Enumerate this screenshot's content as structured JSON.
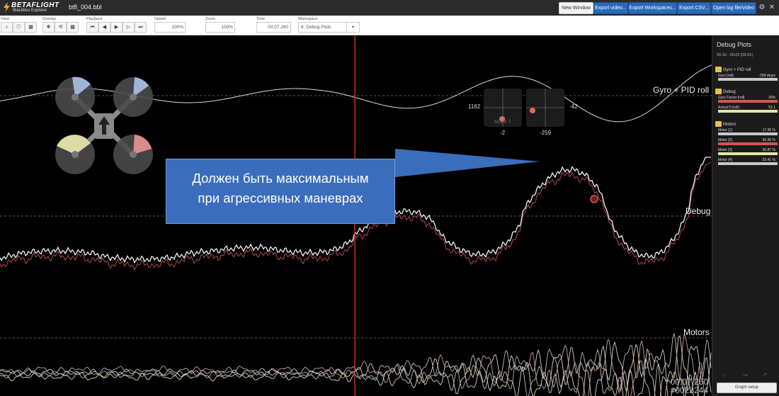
{
  "app": {
    "logo_line1": "BETAFLIGHT",
    "logo_line2": "Blackbox Explorer",
    "filename": "btfl_004.bbl"
  },
  "titlebar": {
    "new_window": "New Window",
    "export_video": "Export video...",
    "export_workspaces": "Export Workspaces...",
    "export_csv": "Export CSV...",
    "open_log": "Open log file/video"
  },
  "toolbar": {
    "view_label": "View",
    "overlay_label": "Overlay",
    "playback_label": "Playback",
    "speed_label": "Speed",
    "speed_value": "100%",
    "zoom_label": "Zoom",
    "zoom_value": "100%",
    "time_label": "Time",
    "time_value": "00:07.260",
    "workspace_label": "Workspace",
    "workspace_value": "6: Debug Plots"
  },
  "graph": {
    "label_gyro": "Gyro + PID roll",
    "label_debug": "Debug",
    "label_motors": "Motors",
    "stick_left_x": "-2",
    "stick_left_y": "1162",
    "stick_right_x": "-259",
    "stick_right_y": "-42",
    "stick_mode": "Mode 2",
    "callout_line1": "Должен быть максимальным",
    "callout_line2": "при агрессивных маневрах",
    "time_readout": "00:07.260",
    "frame_readout": "#0023244"
  },
  "panel": {
    "title": "Debug Plots",
    "range": "00:16 - 00:22 [00:01]",
    "sections": [
      {
        "name": "Gyro + PID roll",
        "series": [
          {
            "name": "Gyro [roll]",
            "value": "-258 deg/s",
            "color": "#c8c8c8"
          }
        ]
      },
      {
        "name": "Debug",
        "series": [
          {
            "name": "Gyro Factor [roll]",
            "value": "30%",
            "color": "#d9534f"
          },
          {
            "name": "Actual D [roll]",
            "value": "51.1",
            "color": "#e8e4a8"
          }
        ]
      },
      {
        "name": "Motors",
        "series": [
          {
            "name": "Motor [1]",
            "value": "17.36 %",
            "color": "#c8c8c8"
          },
          {
            "name": "Motor [2]",
            "value": "55.96 %",
            "color": "#d9534f"
          },
          {
            "name": "Motor [3]",
            "value": "30.87 %",
            "color": "#e8e4a8"
          },
          {
            "name": "Motor [4]",
            "value": "23.41 %",
            "color": "#c8c8c8"
          }
        ]
      }
    ],
    "graph_setup": "Graph setup"
  },
  "colors": {
    "accent_blue": "#2a6ab8",
    "cursor_red": "#d33a3a",
    "callout_bg": "#3a6dbb"
  }
}
